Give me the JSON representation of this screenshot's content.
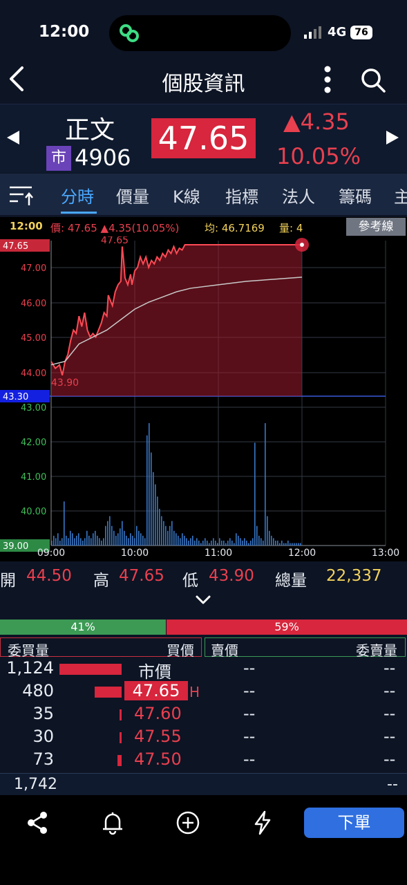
{
  "status": {
    "time": "12:00",
    "network": "4G",
    "battery": "76"
  },
  "nav": {
    "title": "個股資訊"
  },
  "stock": {
    "name": "正文",
    "market_badge": "市",
    "code": "4906",
    "price": "47.65",
    "change_abs": "▲4.35",
    "change_pct": "10.05%",
    "up_color": "#e8404f"
  },
  "tabs": [
    "分時",
    "價量",
    "K線",
    "指標",
    "法人",
    "籌碼",
    "主"
  ],
  "info": {
    "time": "12:00",
    "price_text": "價: 47.65 ▲4.35(10.05%)",
    "avg_text": "均: 46.7169",
    "vol_text": "量: 4",
    "ref_button": "參考線"
  },
  "chart_data": {
    "type": "line",
    "price_ylim": [
      43.3,
      47.65
    ],
    "price_ticks": [
      "47.65",
      "47.00",
      "46.00",
      "45.00",
      "44.00",
      "43.30",
      "43.00",
      "42.00",
      "41.00",
      "40.00",
      "39.00"
    ],
    "x_ticks": [
      "09:00",
      "10:00",
      "11:00",
      "12:00",
      "13:00"
    ],
    "high_label": "47.65",
    "low_label": "43.90",
    "series": [
      {
        "name": "價",
        "points": [
          [
            0,
            44.3
          ],
          [
            3,
            44.1
          ],
          [
            6,
            44.2
          ],
          [
            8,
            43.9
          ],
          [
            10,
            44.3
          ],
          [
            12,
            44.5
          ],
          [
            14,
            44.9
          ],
          [
            16,
            45.2
          ],
          [
            18,
            45.1
          ],
          [
            20,
            45.6
          ],
          [
            22,
            45.3
          ],
          [
            24,
            45.7
          ],
          [
            26,
            45.2
          ],
          [
            28,
            45.0
          ],
          [
            30,
            45.1
          ],
          [
            32,
            45.0
          ],
          [
            34,
            45.2
          ],
          [
            36,
            45.4
          ],
          [
            38,
            45.7
          ],
          [
            40,
            45.6
          ],
          [
            41,
            46.2
          ],
          [
            42,
            46.1
          ],
          [
            44,
            45.9
          ],
          [
            46,
            46.3
          ],
          [
            48,
            46.5
          ],
          [
            50,
            46.6
          ],
          [
            51,
            47.6
          ],
          [
            52,
            47.2
          ],
          [
            53,
            46.7
          ],
          [
            55,
            46.5
          ],
          [
            57,
            46.8
          ],
          [
            58,
            46.5
          ],
          [
            60,
            46.9
          ],
          [
            62,
            47.0
          ],
          [
            64,
            47.3
          ],
          [
            66,
            47.1
          ],
          [
            68,
            47.3
          ],
          [
            70,
            47.0
          ],
          [
            72,
            47.2
          ],
          [
            74,
            47.1
          ],
          [
            76,
            47.3
          ],
          [
            78,
            47.2
          ],
          [
            80,
            47.4
          ],
          [
            82,
            47.3
          ],
          [
            84,
            47.5
          ],
          [
            86,
            47.4
          ],
          [
            88,
            47.6
          ],
          [
            90,
            47.4
          ],
          [
            92,
            47.55
          ],
          [
            94,
            47.5
          ],
          [
            96,
            47.65
          ],
          [
            100,
            47.65
          ],
          [
            120,
            47.65
          ],
          [
            150,
            47.65
          ],
          [
            180,
            47.65
          ]
        ]
      },
      {
        "name": "均",
        "points": [
          [
            0,
            44.2
          ],
          [
            10,
            44.3
          ],
          [
            20,
            44.8
          ],
          [
            30,
            45.0
          ],
          [
            40,
            45.2
          ],
          [
            50,
            45.5
          ],
          [
            60,
            45.8
          ],
          [
            70,
            46.0
          ],
          [
            80,
            46.15
          ],
          [
            90,
            46.3
          ],
          [
            100,
            46.4
          ],
          [
            120,
            46.5
          ],
          [
            140,
            46.6
          ],
          [
            160,
            46.66
          ],
          [
            180,
            46.72
          ]
        ]
      }
    ],
    "volume": [
      2,
      4,
      3,
      5,
      2,
      3,
      18,
      4,
      3,
      6,
      5,
      3,
      4,
      5,
      3,
      2,
      3,
      6,
      4,
      3,
      5,
      6,
      4,
      3,
      2,
      3,
      8,
      10,
      12,
      8,
      6,
      4,
      5,
      7,
      10,
      6,
      4,
      3,
      5,
      4,
      3,
      8,
      6,
      5,
      4,
      3,
      45,
      50,
      38,
      30,
      25,
      20,
      15,
      12,
      10,
      8,
      6,
      8,
      10,
      6,
      5,
      4,
      3,
      5,
      4,
      3,
      2,
      3,
      4,
      2,
      3,
      2,
      1,
      2,
      3,
      2,
      1,
      2,
      3,
      2,
      1,
      3,
      2,
      2,
      1,
      2,
      3,
      2,
      1,
      5,
      4,
      3,
      2,
      3,
      2,
      1,
      2,
      3,
      42,
      8,
      4,
      3,
      2,
      50,
      12,
      6,
      4,
      3,
      2,
      2,
      1,
      2,
      1,
      1,
      2,
      1,
      1,
      1,
      1,
      1,
      1
    ]
  },
  "summary": {
    "open_label": "開",
    "open": "44.50",
    "high_label": "高",
    "high": "47.65",
    "low_label": "低",
    "low": "43.90",
    "total_label": "總量",
    "total": "22,337"
  },
  "ratio": {
    "buy_pct": 41,
    "buy_text": "41%",
    "sell_text": "59%"
  },
  "orderbook": {
    "headers": {
      "buy_qty": "委買量",
      "buy_price": "買價",
      "sell_price": "賣價",
      "sell_qty": "委賣量"
    },
    "rows": [
      {
        "qty": "1,124",
        "price": "市價",
        "sell_price": "--",
        "sell_qty": "--",
        "bar": 1.0
      },
      {
        "qty": "480",
        "price": "47.65",
        "flag": "H",
        "sell_price": "--",
        "sell_qty": "--",
        "bar": 0.43
      },
      {
        "qty": "35",
        "price": "47.60",
        "sell_price": "--",
        "sell_qty": "--",
        "bar": 0.03
      },
      {
        "qty": "30",
        "price": "47.55",
        "sell_price": "--",
        "sell_qty": "--",
        "bar": 0.03
      },
      {
        "qty": "73",
        "price": "47.50",
        "sell_price": "--",
        "sell_qty": "--",
        "bar": 0.07
      }
    ],
    "total_buy": "1,742",
    "total_sell": "--"
  },
  "bottom": {
    "order_button": "下單"
  }
}
